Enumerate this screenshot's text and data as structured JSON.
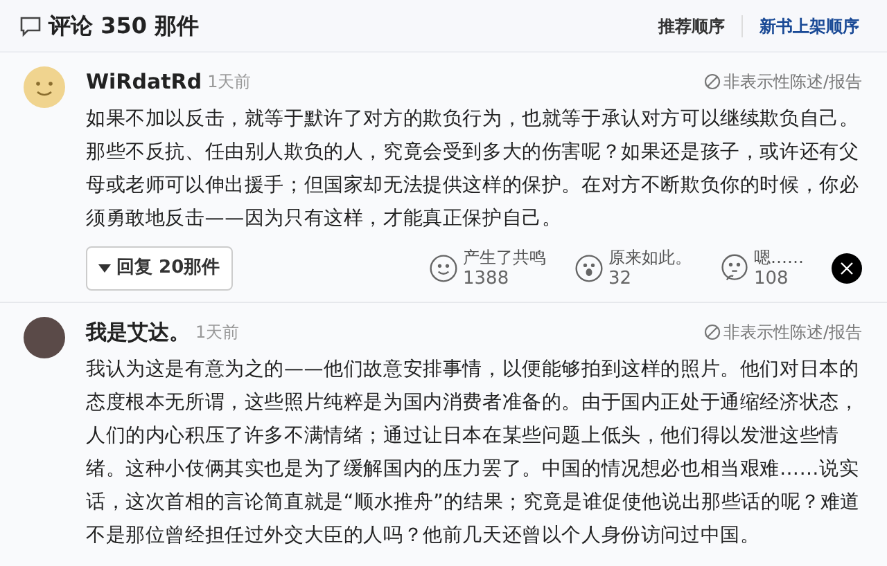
{
  "header": {
    "title": "评论 350 那件",
    "sort_options": [
      {
        "label": "推荐顺序",
        "selected": false
      },
      {
        "label": "新书上架顺序",
        "selected": true
      }
    ]
  },
  "comments": [
    {
      "user": "WiRdatRd",
      "avatar": {
        "kind": "smiley"
      },
      "time": "1天前",
      "report": "非表示性陈述/报告",
      "body": "如果不加以反击，就等于默许了对方的欺负行为，也就等于承认对方可以继续欺负自己。那些不反抗、任由别人欺负的人，究竟会受到多大的伤害呢？如果还是孩子，或许还有父母或老师可以伸出援手；但国家却无法提供这样的保护。在对方不断欺负你的时候，你必须勇敢地反击——因为只有这样，才能真正保护自己。",
      "replies": "回复 20那件",
      "reactions": [
        {
          "kind": "smile",
          "label": "产生了共鸣",
          "count": "1388"
        },
        {
          "kind": "surprised",
          "label": "原来如此。",
          "count": "32"
        },
        {
          "kind": "thinking",
          "label": "嗯……",
          "count": "108"
        }
      ]
    },
    {
      "user": "我是艾达。",
      "avatar": {
        "kind": "photo"
      },
      "time": "1天前",
      "report": "非表示性陈述/报告",
      "body": "我认为这是有意为之的——他们故意安排事情，以便能够拍到这样的照片。他们对日本的态度根本无所谓，这些照片纯粹是为国内消费者准备的。由于国内正处于通缩经济状态，人们的内心积压了许多不满情绪；通过让日本在某些问题上低头，他们得以发泄这些情绪。这种小伎俩其实也是为了缓解国内的压力罢了。中国的情况想必也相当艰难……说实话，这次首相的言论简直就是“顺水推舟”的结果；究竟是谁促使他说出那些话的呢？难道不是那位曾经担任过外交大臣的人吗？他前几天还曾以个人身份访问过中国。"
    }
  ]
}
